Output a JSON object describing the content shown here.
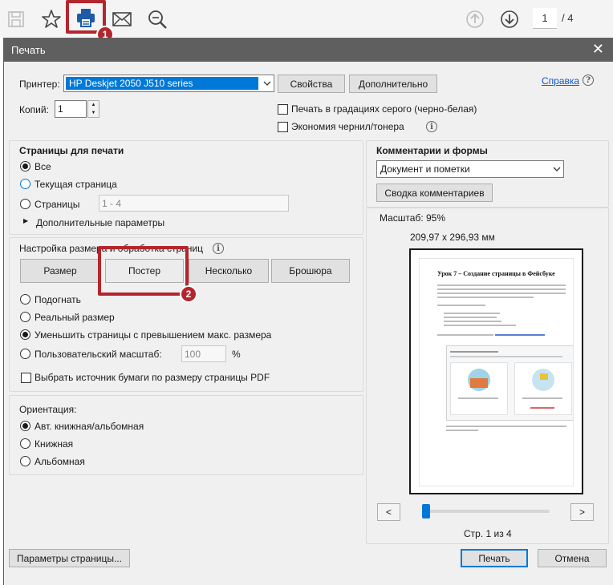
{
  "toolbar": {
    "icons": [
      "save-icon",
      "bookmark-star-icon",
      "print-icon",
      "mail-icon",
      "search-zoom-icon",
      "page-up-icon",
      "page-down-icon"
    ],
    "current_page": "1",
    "page_total": "/ 4",
    "badge1": "1"
  },
  "dialog": {
    "title": "Печать",
    "printer_label": "Принтер:",
    "printer_value": "HP Deskjet 2050 J510 series",
    "properties_button": "Свойства",
    "advanced_button": "Дополнительно",
    "help_link": "Справка",
    "copies_label": "Копий:",
    "copies_value": "1",
    "grayscale_label": "Печать в градациях серого (черно-белая)",
    "save_ink_label": "Экономия чернил/тонера"
  },
  "pages_section": {
    "title": "Страницы для печати",
    "all": "Все",
    "current": "Текущая страница",
    "pages": "Страницы",
    "pages_value": "1 - 4",
    "more": "Дополнительные параметры"
  },
  "size_section": {
    "title": "Настройка размера и обработка страниц",
    "tabs": [
      "Размер",
      "Постер",
      "Несколько",
      "Брошюра"
    ],
    "badge2": "2",
    "fit": "Подогнать",
    "actual": "Реальный размер",
    "shrink": "Уменьшить страницы с превышением макс. размера",
    "custom": "Пользовательский масштаб:",
    "custom_value": "100",
    "percent": "%",
    "paper_source": "Выбрать источник бумаги по размеру страницы PDF"
  },
  "orientation": {
    "title": "Ориентация:",
    "auto": "Авт. книжная/альбомная",
    "portrait": "Книжная",
    "landscape": "Альбомная"
  },
  "comments": {
    "title": "Комментарии и формы",
    "select_value": "Документ и пометки",
    "summary_button": "Сводка комментариев"
  },
  "preview": {
    "scale": "Масштаб:  95%",
    "size": "209,97 x 296,93 мм",
    "doc_title": "Урок 7 – Создание страницы в Фейсбуке",
    "page_info": "Стр. 1 из 4",
    "prev": "<",
    "next": ">"
  },
  "footer": {
    "page_setup": "Параметры страницы...",
    "print": "Печать",
    "cancel": "Отмена"
  },
  "colors": {
    "highlight": "#b3262d",
    "accent": "#0078d7",
    "titlebar": "#5f5f5f"
  }
}
